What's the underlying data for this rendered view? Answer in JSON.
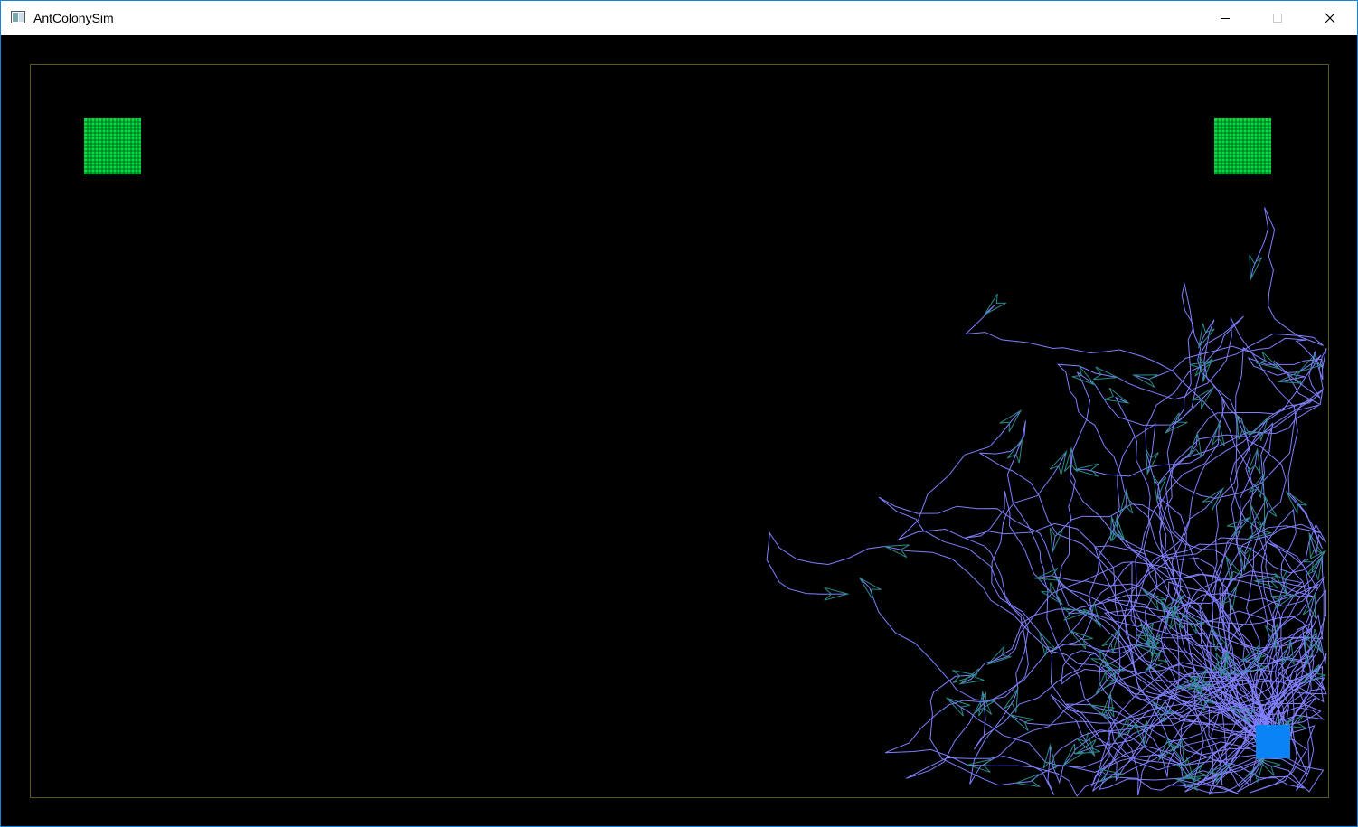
{
  "window": {
    "title": "AntColonySim",
    "app_icon": "window-app-icon",
    "controls": {
      "minimize_icon": "minimize-icon",
      "maximize_icon": "maximize-icon",
      "close_icon": "close-icon"
    }
  },
  "simulation": {
    "colors": {
      "background": "#000000",
      "boundary": "#5a5a1e",
      "food": "#00e040",
      "food_grid": "#006b20",
      "nest": "#0a84f5",
      "trail": "#8080ff",
      "ant": "#2a8a8a"
    },
    "food_sources": 2,
    "nests": 1
  }
}
